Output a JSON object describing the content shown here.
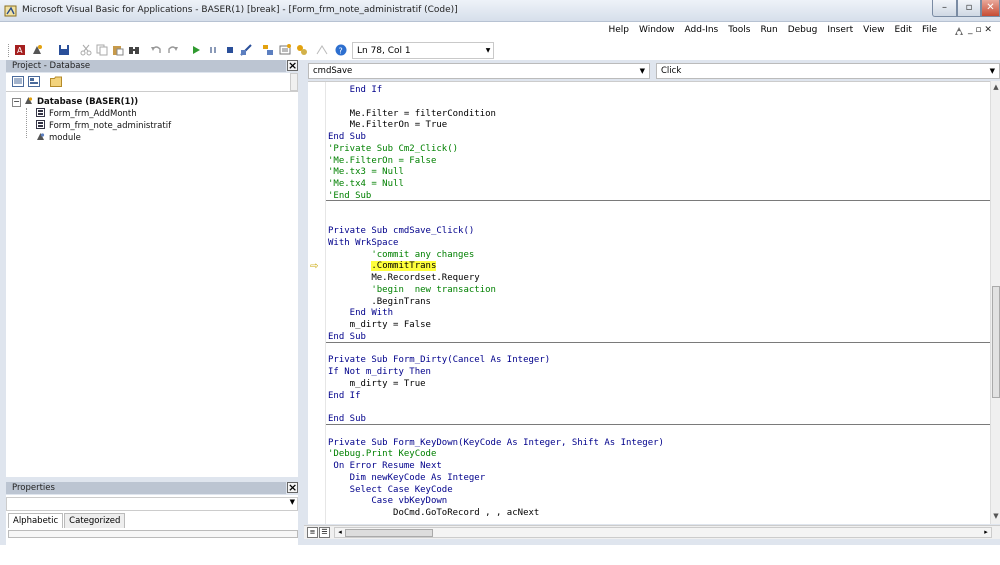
{
  "window": {
    "title": "Microsoft Visual Basic for Applications - BASER(1) [break] - [Form_frm_note_administratif (Code)]",
    "controls": {
      "minimize": "–",
      "maximize": "▫",
      "close": "✕"
    }
  },
  "menubar": {
    "items": [
      "Help",
      "Window",
      "Add-Ins",
      "Tools",
      "Run",
      "Debug",
      "Insert",
      "View",
      "Edit",
      "File"
    ],
    "mdi_controls": "_ ▫ ✕"
  },
  "toolbar": {
    "position_label": "Ln 78, Col 1",
    "icons": [
      "access-icon",
      "insert-module-icon",
      "save-icon",
      "cut-icon",
      "copy-icon",
      "paste-icon",
      "find-icon",
      "undo-icon",
      "redo-icon",
      "run-icon",
      "break-icon",
      "reset-icon",
      "design-mode-icon",
      "project-explorer-icon",
      "properties-icon",
      "object-browser-icon",
      "toolbox-icon",
      "help-icon"
    ]
  },
  "project_pane": {
    "title": "Project - Database",
    "tree": [
      {
        "label": "Database (BASER(1))",
        "level": 0,
        "icon": "project-icon"
      },
      {
        "label": "Form_frm_AddMonth",
        "level": 1,
        "icon": "form-module-icon"
      },
      {
        "label": "Form_frm_note_administratif",
        "level": 1,
        "icon": "form-module-icon"
      },
      {
        "label": "module",
        "level": 1,
        "icon": "module-icon"
      }
    ]
  },
  "properties_pane": {
    "title": "Properties",
    "tabs": [
      "Alphabetic",
      "Categorized"
    ],
    "active_tab": "Alphabetic"
  },
  "code_window": {
    "object_combo": "cmdSave",
    "procedure_combo": "Click",
    "current_line_marker": "⇨",
    "lines": [
      {
        "text": "    End If",
        "class": "kw"
      },
      {
        "text": "",
        "class": "tx"
      },
      {
        "text": "    Me.Filter = filterCondition",
        "class": "tx"
      },
      {
        "text": "    Me.FilterOn = True",
        "class": "tx"
      },
      {
        "text": "End Sub",
        "class": "kw"
      },
      {
        "text": "'Private Sub Cm2_Click()",
        "class": "cm"
      },
      {
        "text": "'Me.FilterOn = False",
        "class": "cm"
      },
      {
        "text": "'Me.tx3 = Null",
        "class": "cm"
      },
      {
        "text": "'Me.tx4 = Null",
        "class": "cm"
      },
      {
        "text": "'End Sub",
        "class": "cm"
      },
      {
        "text": "",
        "class": "tx"
      },
      {
        "text": "",
        "class": "tx"
      },
      {
        "text": "Private Sub cmdSave_Click()",
        "class": "kw"
      },
      {
        "text": "With WrkSpace",
        "class": "kw"
      },
      {
        "text": "        'commit any changes",
        "class": "cm"
      },
      {
        "text": ".CommitTrans",
        "class": "hl",
        "indent": "        "
      },
      {
        "text": "        Me.Recordset.Requery",
        "class": "tx"
      },
      {
        "text": "        'begin  new transaction",
        "class": "cm"
      },
      {
        "text": "        .BeginTrans",
        "class": "tx"
      },
      {
        "text": "    End With",
        "class": "kw"
      },
      {
        "text": "    m_dirty = False",
        "class": "tx"
      },
      {
        "text": "End Sub",
        "class": "kw"
      },
      {
        "text": "",
        "class": "tx"
      },
      {
        "text": "Private Sub Form_Dirty(Cancel As Integer)",
        "class": "kw"
      },
      {
        "text": "If Not m_dirty Then",
        "class": "kw"
      },
      {
        "text": "    m_dirty = True",
        "class": "tx"
      },
      {
        "text": "End If",
        "class": "kw"
      },
      {
        "text": "",
        "class": "tx"
      },
      {
        "text": "End Sub",
        "class": "kw"
      },
      {
        "text": "",
        "class": "tx"
      },
      {
        "text": "Private Sub Form_KeyDown(KeyCode As Integer, Shift As Integer)",
        "class": "kw"
      },
      {
        "text": "'Debug.Print KeyCode",
        "class": "cm"
      },
      {
        "text": " On Error Resume Next",
        "class": "kw"
      },
      {
        "text": "    Dim newKeyCode As Integer",
        "class": "kw"
      },
      {
        "text": "    Select Case KeyCode",
        "class": "kw"
      },
      {
        "text": "        Case vbKeyDown",
        "class": "kw"
      },
      {
        "text": "            DoCmd.GoToRecord , , acNext",
        "class": "tx"
      }
    ]
  },
  "colors": {
    "keyword": "#00008b",
    "comment": "#008000",
    "highlight": "#ffff3c",
    "pane_title_bg": "#bcc5d2"
  }
}
